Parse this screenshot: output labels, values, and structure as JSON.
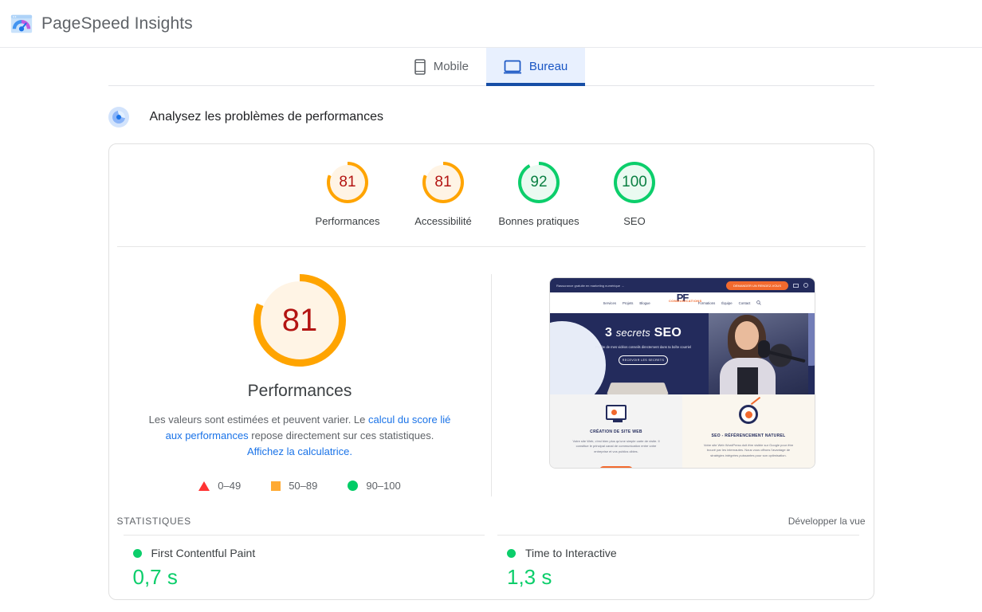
{
  "header": {
    "title": "PageSpeed Insights",
    "logo_icon": "pagespeed-logo-icon"
  },
  "tabs": [
    {
      "label": "Mobile",
      "icon": "mobile-phone-icon",
      "active": false
    },
    {
      "label": "Bureau",
      "icon": "desktop-monitor-icon",
      "active": true
    }
  ],
  "analyze": {
    "icon": "performance-gauge-icon",
    "title": "Analysez les problèmes de performances"
  },
  "gauges": [
    {
      "score": "81",
      "label": "Performances",
      "color": "#ffa400",
      "text_color": "#b31412",
      "fill": "#fff4e5",
      "percent": 81
    },
    {
      "score": "81",
      "label": "Accessibilité",
      "color": "#ffa400",
      "text_color": "#b31412",
      "fill": "#fff4e5",
      "percent": 81
    },
    {
      "score": "92",
      "label": "Bonnes pratiques",
      "color": "#0cce6b",
      "text_color": "#0b8043",
      "fill": "#eafaf1",
      "percent": 92
    },
    {
      "score": "100",
      "label": "SEO",
      "color": "#0cce6b",
      "text_color": "#0b8043",
      "fill": "#eafaf1",
      "percent": 100
    }
  ],
  "summary": {
    "score": "81",
    "title": "Performances",
    "color": "#ffa400",
    "text_color": "#b31412",
    "fill": "#fff4e5",
    "percent": 81,
    "desc_part1": "Les valeurs sont estimées et peuvent varier. Le ",
    "desc_link1": "calcul du score lié aux performances",
    "desc_part2": " repose directement sur ces statistiques. ",
    "desc_link2": "Affichez la calculatrice.",
    "legend": [
      {
        "shape": "triangle",
        "range": "0–49",
        "color": "#ff3333"
      },
      {
        "shape": "square",
        "range": "50–89",
        "color": "#ffaa33"
      },
      {
        "shape": "circle",
        "range": "90–100",
        "color": "#00cc66"
      }
    ]
  },
  "thumbnail": {
    "alt_name": "page-screenshot-thumbnail",
    "topbar_text": "Rassurance gratuite en marketing numérique →",
    "topbar_cta": "DEMANDER UN RENDEZ-VOUS",
    "nav": [
      "Services",
      "Projets",
      "Blogue",
      "Formations",
      "Équipe",
      "Contact"
    ],
    "logo_main": "PF",
    "logo_sub": "COMMUNICATIONS",
    "hero_number": "3",
    "hero_script": "secrets",
    "hero_bold": "SEO",
    "hero_sub": "Profite de mes vidéos conseils directement dans ta boîte courriel",
    "hero_button": "RECEVOIR LES SECRETS",
    "card_left_title": "CRÉATION DE SITE WEB",
    "card_left_body": "Votre site Web, c'est bien plus qu'une simple carte de visite. Il constitue le principal canal de communication entre votre entreprise et vos publics cibles.",
    "card_right_title": "SEO - RÉFÉRENCEMENT NATUREL",
    "card_right_body": "Votre site Web WordPress doit être visible sur Google pour être trouvé par les internautes. Nous vous offrons l'avantage de stratégies intégrées puissantes pour son optimisation."
  },
  "statistics": {
    "title": "STATISTIQUES",
    "expand_label": "Développer la vue",
    "metrics": [
      {
        "name": "First Contentful Paint",
        "value": "0,7 s",
        "status_color": "#0cce6b"
      },
      {
        "name": "Time to Interactive",
        "value": "1,3 s",
        "status_color": "#0cce6b"
      }
    ]
  }
}
